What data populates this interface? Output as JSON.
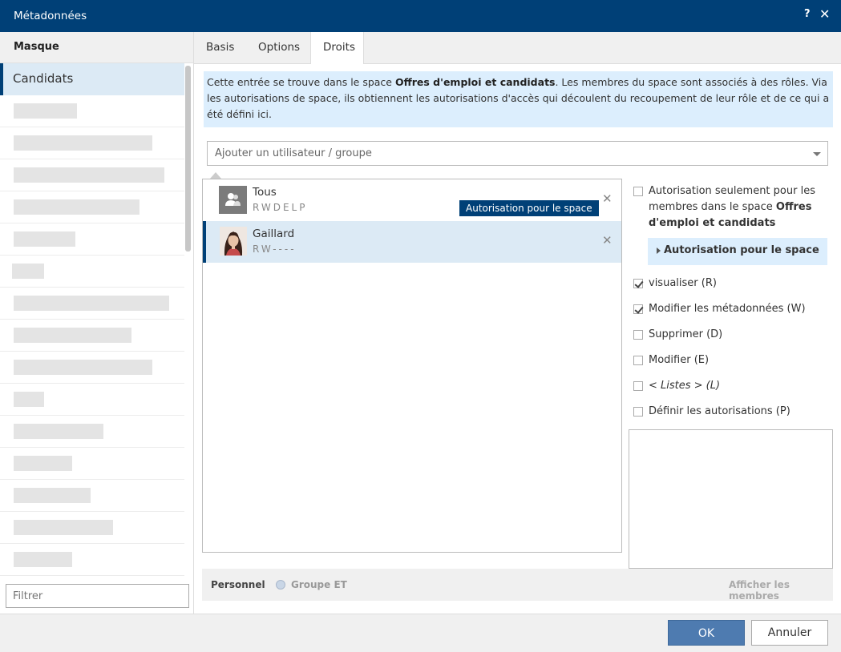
{
  "window": {
    "title": "Métadonnées",
    "help": "?",
    "close": "✕"
  },
  "left": {
    "header": "Masque",
    "selected_item": "Candidats",
    "filter_placeholder": "Filtrer"
  },
  "tabs": [
    {
      "label": "Basis"
    },
    {
      "label": "Options"
    },
    {
      "label": "Droits"
    }
  ],
  "info": {
    "part1": "Cette entrée se trouve dans le space ",
    "space_name": "Offres d'emploi et candidats",
    "part2": ". Les membres du space sont associés à des rôles. Via les autorisations de space, ils obtiennent les autorisations d'accès qui découlent du recoupement de leur rôle et de ce qui a été défini ici."
  },
  "user_select": {
    "placeholder": "Ajouter un utilisateur / groupe"
  },
  "users": [
    {
      "name": "Tous",
      "rights": "RWDELP",
      "badge": "Autorisation pour le space"
    },
    {
      "name": "Gaillard",
      "rights": "RW----"
    }
  ],
  "rights": {
    "only_members_text1": "Autorisation seulement pour les membres dans le space ",
    "only_members_space": "Offres d'emploi et candidats",
    "auth_space_label": "Autorisation pour le space",
    "items": [
      {
        "label": "visualiser (R)",
        "checked": true
      },
      {
        "label": "Modifier les métadonnées (W)",
        "checked": true
      },
      {
        "label": "Supprimer (D)",
        "checked": false
      },
      {
        "label": "Modifier (E)",
        "checked": false
      },
      {
        "label": "< Listes > (L)",
        "checked": false
      },
      {
        "label": "Définir les autorisations (P)",
        "checked": false
      }
    ]
  },
  "footer": {
    "personnel": "Personnel",
    "groupe": "Groupe ET",
    "members": "Afficher les membres"
  },
  "buttons": {
    "ok": "OK",
    "cancel": "Annuler"
  }
}
